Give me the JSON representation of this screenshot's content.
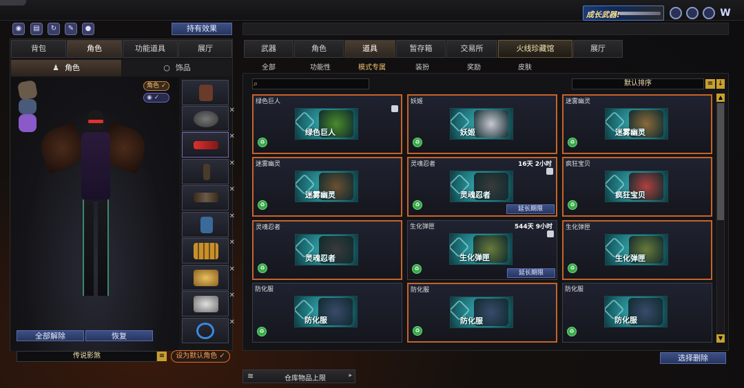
{
  "top": {
    "banner_text": "成长武器!"
  },
  "left": {
    "effects_button": "持有效果",
    "tabs": [
      {
        "label": "背包",
        "active": false
      },
      {
        "label": "角色",
        "active": true
      },
      {
        "label": "功能道具",
        "active": false
      },
      {
        "label": "展厅",
        "active": false
      }
    ],
    "subtabs": [
      {
        "label": "角色",
        "active": true
      },
      {
        "label": "饰品",
        "active": false
      }
    ],
    "toggle_role": "角色",
    "release_all": "全部解除",
    "restore": "恢复",
    "character_name": "传说影煞",
    "set_default": "设为默认角色"
  },
  "right": {
    "tabs": [
      {
        "label": "武器",
        "active": false
      },
      {
        "label": "角色",
        "active": false
      },
      {
        "label": "道具",
        "active": true
      },
      {
        "label": "暂存箱",
        "active": false
      },
      {
        "label": "交易所",
        "active": false
      },
      {
        "label": "火线珍藏馆",
        "active": false
      },
      {
        "label": "展厅",
        "active": false
      }
    ],
    "filters": [
      {
        "label": "全部",
        "active": false
      },
      {
        "label": "功能性",
        "active": false
      },
      {
        "label": "模式专属",
        "active": true
      },
      {
        "label": "装扮",
        "active": false
      },
      {
        "label": "奖励",
        "active": false
      },
      {
        "label": "皮肤",
        "active": false
      }
    ],
    "search_placeholder": "",
    "sort_label": "默认排序",
    "items": [
      {
        "name": "绿色巨人",
        "thumb_label": "绿色巨人",
        "time": "",
        "extend": "",
        "selected": true,
        "lock": true,
        "art": "#4a8a2a"
      },
      {
        "name": "妖姬",
        "thumb_label": "妖姬",
        "time": "",
        "extend": "",
        "selected": true,
        "lock": false,
        "art": "#c8c8d0"
      },
      {
        "name": "迷雾幽灵",
        "thumb_label": "迷雾幽灵",
        "time": "",
        "extend": "",
        "selected": true,
        "lock": false,
        "art": "#8a6a3a"
      },
      {
        "name": "迷雾幽灵",
        "thumb_label": "迷雾幽灵",
        "time": "",
        "extend": "",
        "selected": true,
        "lock": false,
        "art": "#6a5030"
      },
      {
        "name": "灵魂忍者",
        "thumb_label": "灵魂忍者",
        "time": "16天 2小时",
        "extend": "延长期限",
        "selected": true,
        "lock": true,
        "art": "#3a3a3a"
      },
      {
        "name": "疯狂宝贝",
        "thumb_label": "疯狂宝贝",
        "time": "",
        "extend": "",
        "selected": true,
        "lock": false,
        "art": "#b04040"
      },
      {
        "name": "灵魂忍者",
        "thumb_label": "灵魂忍者",
        "time": "",
        "extend": "",
        "selected": true,
        "lock": false,
        "art": "#3a3a3a"
      },
      {
        "name": "生化弹匣",
        "thumb_label": "生化弹匣",
        "time": "544天 9小时",
        "extend": "延长期限",
        "selected": false,
        "lock": true,
        "art": "#6a7a3a"
      },
      {
        "name": "生化弹匣",
        "thumb_label": "生化弹匣",
        "time": "",
        "extend": "",
        "selected": true,
        "lock": false,
        "art": "#6a7a3a"
      },
      {
        "name": "防化服",
        "thumb_label": "防化服",
        "time": "",
        "extend": "",
        "selected": false,
        "lock": false,
        "art": "#3a4a6a"
      },
      {
        "name": "防化服",
        "thumb_label": "防化服",
        "time": "",
        "extend": "",
        "selected": true,
        "lock": false,
        "art": "#3a4a6a"
      },
      {
        "name": "防化服",
        "thumb_label": "防化服",
        "time": "",
        "extend": "",
        "selected": false,
        "lock": false,
        "art": "#3a4a6a"
      }
    ],
    "select_delete": "选择删除",
    "storage_limit": "仓库物品上限"
  }
}
